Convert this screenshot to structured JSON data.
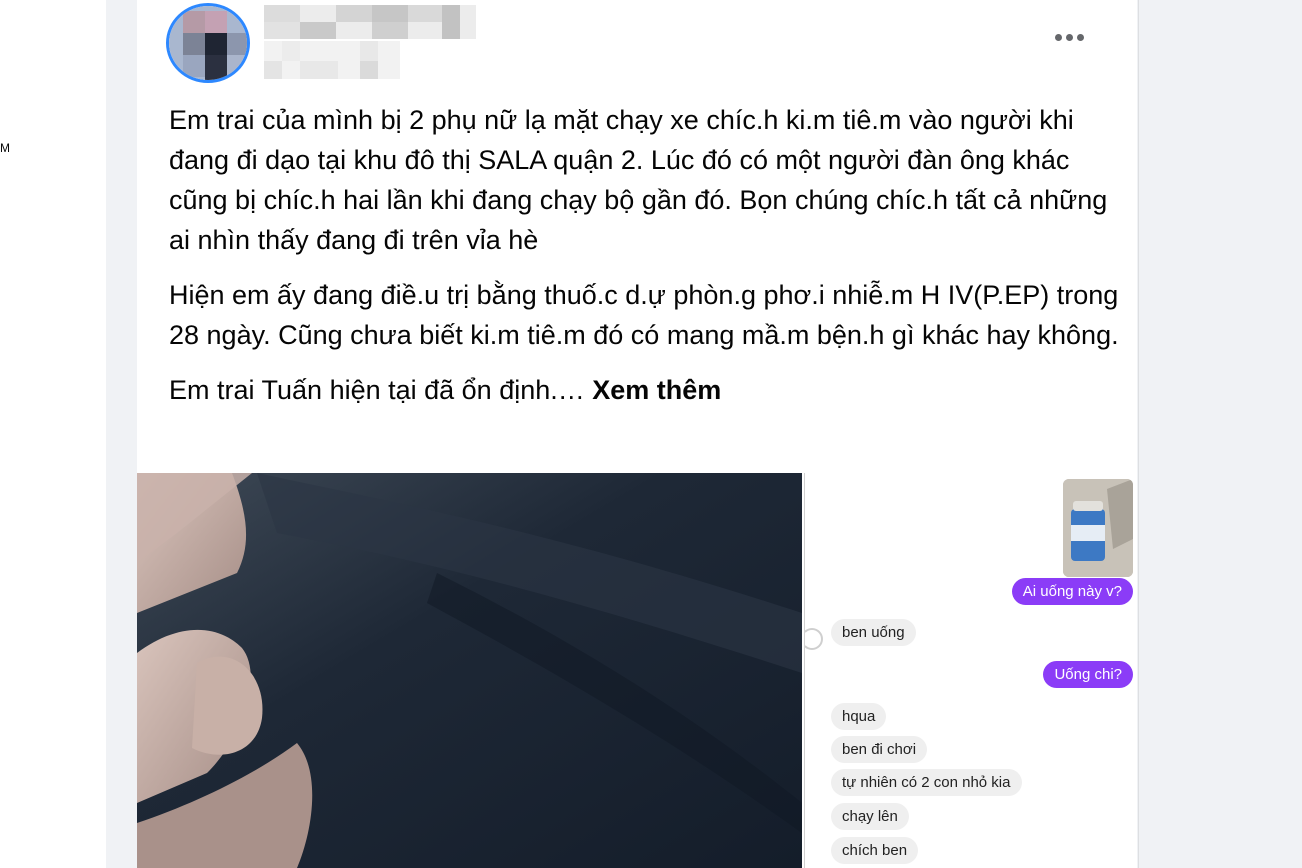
{
  "left_pane": {
    "stub_text": "M"
  },
  "post": {
    "menu_icon": "ellipsis-icon",
    "paragraphs": [
      "Em trai của mình bị 2 phụ nữ lạ mặt chạy xe chíc.h ki.m tiê.m vào người khi đang đi dạo tại khu đô thị SALA quận 2. Lúc đó có một người đàn ông khác cũng bị chíc.h hai lần khi đang chạy bộ gần đó. Bọn chúng chíc.h tất cả những ai nhìn thấy đang đi trên vỉa hè",
      "Hiện em ấy đang điề.u trị bằng thuố.c d.ự phòn.g phơ.i nhiễ.m H IV(P.EP) trong 28 ngày. Cũng chưa biết ki.m tiê.m đó có mang mầ.m bện.h gì khác hay không."
    ],
    "last_paragraph": "Em trai Tuấn hiện tại đã ổn định.…",
    "see_more": "Xem thêm"
  },
  "chat": {
    "outgoing_1": "Ai uống này v?",
    "incoming_1": "ben uống",
    "outgoing_2": "Uống chi?",
    "incoming_list": [
      "hqua",
      "ben đi chơi",
      "tự nhiên có 2 con nhỏ kia",
      "chạy lên",
      "chích ben"
    ]
  },
  "colors": {
    "accent": "#8b3cf7",
    "avatar_ring": "#2d88ff",
    "page_bg": "#f0f2f5"
  }
}
